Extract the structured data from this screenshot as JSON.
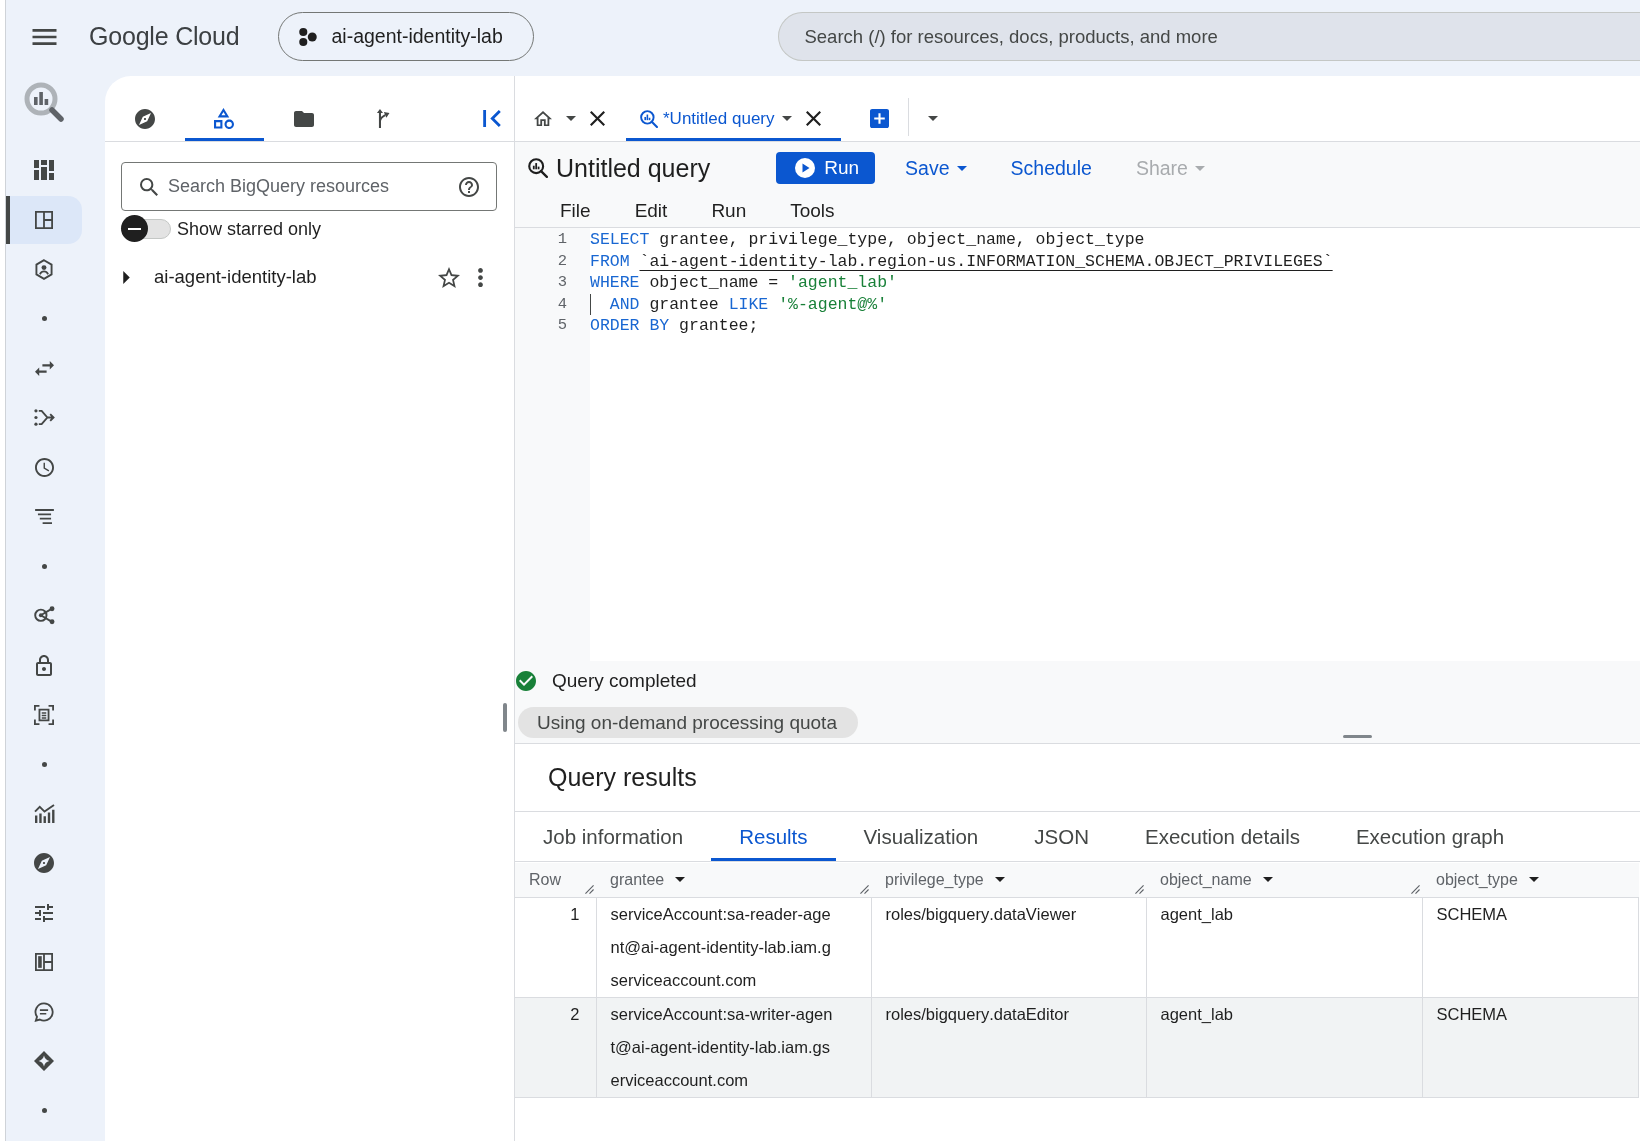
{
  "top_bar": {
    "logo": "Google Cloud",
    "project": "ai-agent-identity-lab",
    "search": {
      "placeholder": "Search (/) for resources, docs, products, and more"
    }
  },
  "nav_rail": {
    "groups": [
      [
        {
          "selected": false
        },
        {
          "selected": true
        },
        {
          "selected": false
        }
      ],
      [
        {
          "selected": false
        },
        {
          "selected": false
        },
        {
          "selected": false
        },
        {
          "selected": false
        }
      ],
      [
        {
          "selected": false
        },
        {
          "selected": false
        },
        {
          "selected": false
        }
      ],
      [
        {
          "selected": false
        },
        {
          "selected": false
        },
        {
          "selected": false
        },
        {
          "selected": false
        },
        {
          "selected": false
        },
        {
          "selected": false
        }
      ]
    ]
  },
  "explorer": {
    "tabs": [
      {
        "selected": false
      },
      {
        "selected": true
      },
      {
        "selected": false
      },
      {
        "selected": false
      }
    ],
    "search": {
      "placeholder": "Search BigQuery resources"
    },
    "starred_filter": {
      "label": "Show starred only",
      "on": false
    },
    "tree": [
      {
        "label": "ai-agent-identity-lab",
        "expanded": false,
        "starred": false
      }
    ]
  },
  "editor_tabs": [
    {
      "kind": "home",
      "selected": false
    },
    {
      "kind": "query",
      "label": "*Untitled query",
      "selected": true
    }
  ],
  "query": {
    "title": "Untitled query",
    "actions": [
      {
        "kind": "primary",
        "label": "Run",
        "disabled": false
      },
      {
        "kind": "dropdown",
        "label": "Save",
        "disabled": false
      },
      {
        "kind": "text",
        "label": "Schedule",
        "disabled": false
      },
      {
        "kind": "dropdown",
        "label": "Share",
        "disabled": true
      }
    ],
    "menu": [
      "File",
      "Edit",
      "Run",
      "Tools"
    ],
    "code": [
      {
        "number": "1",
        "indent": false,
        "tokens": [
          {
            "kind": "keyword",
            "text": "SELECT"
          },
          {
            "kind": "plain",
            "text": " grantee, privilege_type, object_name, object_type"
          }
        ]
      },
      {
        "number": "2",
        "indent": false,
        "tokens": [
          {
            "kind": "keyword",
            "text": "FROM "
          },
          {
            "kind": "table_ref",
            "text": "`ai-agent-identity-lab.region-us.INFORMATION_SCHEMA.OBJECT_PRIVILEGES`"
          }
        ]
      },
      {
        "number": "3",
        "indent": false,
        "tokens": [
          {
            "kind": "keyword",
            "text": "WHERE"
          },
          {
            "kind": "plain",
            "text": " object_name = "
          },
          {
            "kind": "string",
            "text": "'agent_lab'"
          }
        ]
      },
      {
        "number": "4",
        "indent": true,
        "tokens": [
          {
            "kind": "keyword",
            "text": "AND"
          },
          {
            "kind": "plain",
            "text": " grantee "
          },
          {
            "kind": "keyword",
            "text": "LIKE "
          },
          {
            "kind": "string",
            "text": "'%-agent@%'"
          }
        ]
      },
      {
        "number": "5",
        "indent": false,
        "tokens": [
          {
            "kind": "keyword",
            "text": "ORDER BY"
          },
          {
            "kind": "plain",
            "text": " grantee;"
          }
        ]
      }
    ],
    "status": "Query completed",
    "quota": "Using on-demand processing quota"
  },
  "results": {
    "title": "Query results",
    "tabs": [
      {
        "label": "Job information",
        "selected": false
      },
      {
        "label": "Results",
        "selected": true
      },
      {
        "label": "Visualization",
        "selected": false
      },
      {
        "label": "JSON",
        "selected": false
      },
      {
        "label": "Execution details",
        "selected": false
      },
      {
        "label": "Execution graph",
        "selected": false
      }
    ],
    "table": {
      "columns": [
        {
          "label": "Row",
          "menu": false
        },
        {
          "label": "grantee",
          "menu": true
        },
        {
          "label": "privilege_type",
          "menu": true
        },
        {
          "label": "object_name",
          "menu": true
        },
        {
          "label": "object_type",
          "menu": true
        }
      ],
      "rows": [
        {
          "highlighted": false,
          "cells": [
            "1",
            "serviceAccount:sa-reader-agent@ai-agent-identity-lab.iam.gserviceaccount.com",
            "roles/bigquery.dataViewer",
            "agent_lab",
            "SCHEMA"
          ]
        },
        {
          "highlighted": true,
          "cells": [
            "2",
            "serviceAccount:sa-writer-agent@ai-agent-identity-lab.iam.gserviceaccount.com",
            "roles/bigquery.dataEditor",
            "agent_lab",
            "SCHEMA"
          ]
        }
      ]
    }
  }
}
